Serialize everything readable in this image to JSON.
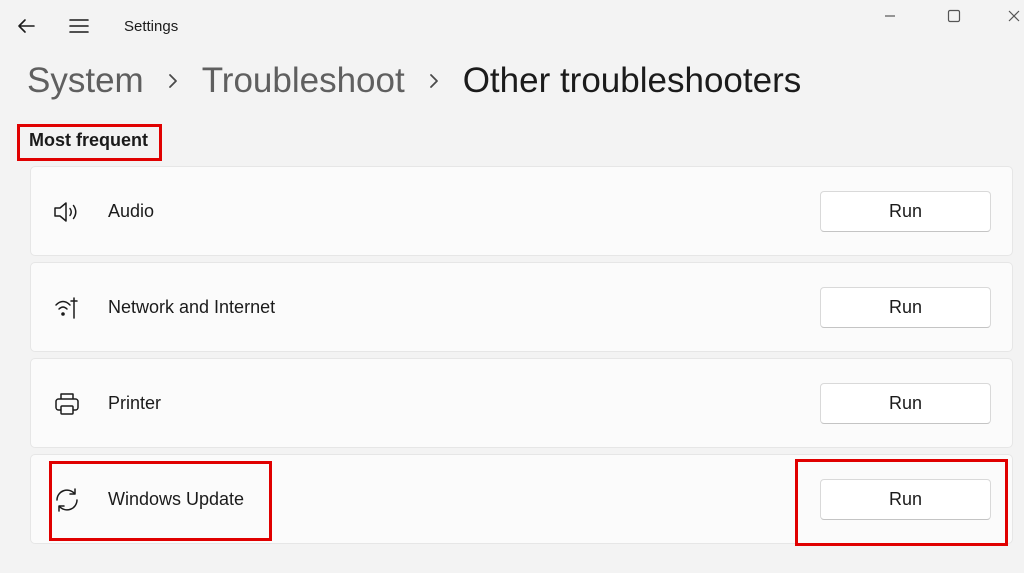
{
  "titlebar": {
    "title": "Settings",
    "back_icon": "back-arrow-icon",
    "menu_icon": "hamburger-menu-icon",
    "window_controls": [
      "minimize",
      "maximize",
      "close"
    ]
  },
  "breadcrumb": {
    "items": [
      "System",
      "Troubleshoot",
      "Other troubleshooters"
    ],
    "separator_icon": "chevron-right-icon"
  },
  "section": {
    "title": "Most frequent"
  },
  "troubleshooters": [
    {
      "label": "Audio",
      "icon": "speaker-icon",
      "button": "Run"
    },
    {
      "label": "Network and Internet",
      "icon": "network-icon",
      "button": "Run"
    },
    {
      "label": "Printer",
      "icon": "printer-icon",
      "button": "Run"
    },
    {
      "label": "Windows Update",
      "icon": "sync-icon",
      "button": "Run"
    }
  ],
  "annotations": {
    "highlight_color": "#e00000"
  }
}
